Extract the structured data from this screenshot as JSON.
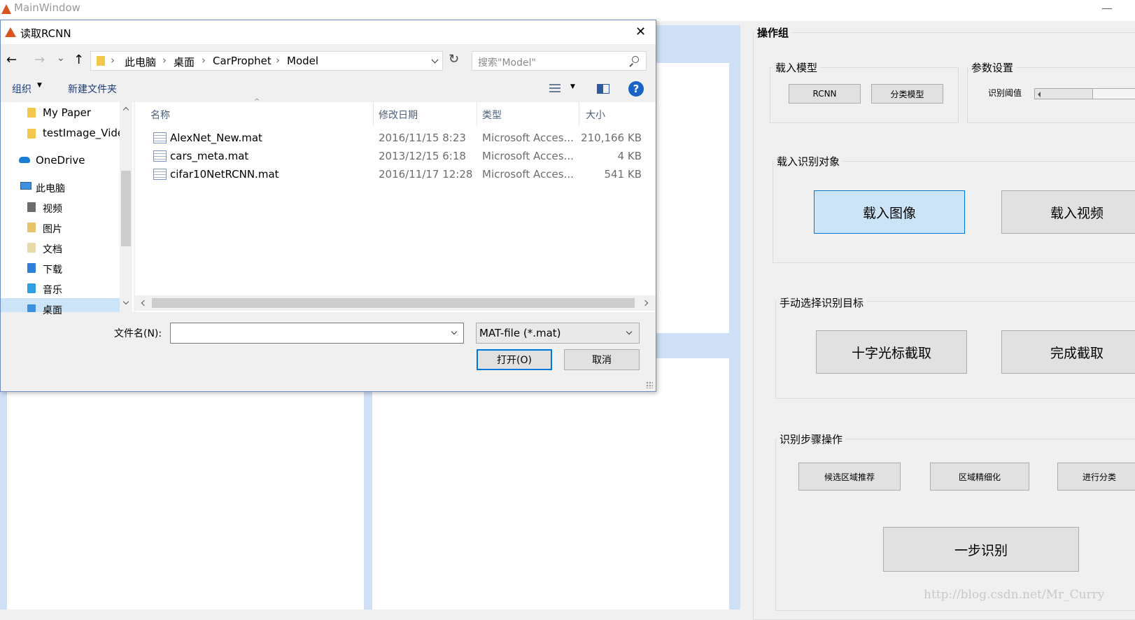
{
  "main_window": {
    "title": "MainWindow",
    "minimize_glyph": "—"
  },
  "panel": {
    "title": "操作组",
    "load_model": {
      "title": "载入模型",
      "rcnn": "RCNN",
      "classify": "分类模型"
    },
    "params": {
      "title": "参数设置",
      "threshold_label": "识别阈值",
      "threshold_level": 0.25
    },
    "load_target": {
      "title": "载入识别对象",
      "image": "载入图像",
      "video": "载入视频"
    },
    "manual": {
      "title": "手动选择识别目标",
      "crosshair": "十字光标截取",
      "finish": "完成截取"
    },
    "steps": {
      "title": "识别步骤操作",
      "candidate": "候选区域推荐",
      "refine": "区域精细化",
      "classify": "进行分类",
      "one_step": "一步识别"
    }
  },
  "watermark": "http://blog.csdn.net/Mr_Curry",
  "dialog": {
    "title": "读取RCNN",
    "close_glyph": "✕",
    "nav": {
      "back": "←",
      "forward": "→",
      "recent": "⌄",
      "up": "↑"
    },
    "breadcrumb": [
      "此电脑",
      "桌面",
      "CarProphet",
      "Model"
    ],
    "breadcrumb_sep": "›",
    "search_placeholder": "搜索\"Model\"",
    "toolbar": {
      "organize": "组织",
      "new_folder": "新建文件夹",
      "help": "?"
    },
    "sidebar": [
      {
        "label": "My Paper",
        "icon": "folder-icon"
      },
      {
        "label": "testImage_Vide",
        "icon": "folder-icon"
      },
      {
        "label": "OneDrive",
        "icon": "cloud-icon"
      },
      {
        "label": "此电脑",
        "icon": "computer-icon"
      },
      {
        "label": "视频",
        "icon": "video-folder-icon"
      },
      {
        "label": "图片",
        "icon": "picture-folder-icon"
      },
      {
        "label": "文档",
        "icon": "document-folder-icon"
      },
      {
        "label": "下载",
        "icon": "download-folder-icon"
      },
      {
        "label": "音乐",
        "icon": "music-folder-icon"
      },
      {
        "label": "桌面",
        "icon": "desktop-folder-icon"
      }
    ],
    "columns": {
      "name": "名称",
      "date": "修改日期",
      "type": "类型",
      "size": "大小"
    },
    "files": [
      {
        "name": "AlexNet_New.mat",
        "date": "2016/11/15 8:23",
        "type": "Microsoft Acces...",
        "size": "210,166 KB"
      },
      {
        "name": "cars_meta.mat",
        "date": "2013/12/15 6:18",
        "type": "Microsoft Acces...",
        "size": "4 KB"
      },
      {
        "name": "cifar10NetRCNN.mat",
        "date": "2016/11/17 12:28",
        "type": "Microsoft Acces...",
        "size": "541 KB"
      }
    ],
    "filename_label": "文件名(N):",
    "filename_value": "",
    "filetype": "MAT-file (*.mat)",
    "open": "打开(O)",
    "cancel": "取消"
  }
}
